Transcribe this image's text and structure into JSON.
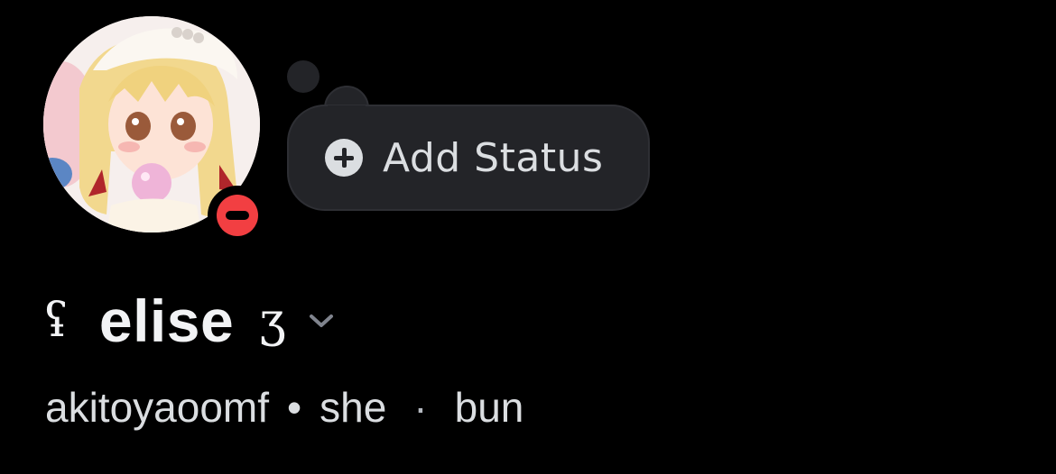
{
  "profile": {
    "display_name": "elise",
    "decoration_left": "ʢ",
    "decoration_right": "ʒ",
    "username": "akitoyaoomf",
    "separator_1": "•",
    "pronoun": "she",
    "separator_2": "·",
    "extra": "bun",
    "presence": "do-not-disturb"
  },
  "status": {
    "button_label": "Add Status",
    "icon": "plus-circle-icon"
  },
  "icons": {
    "expand": "chevron-down-icon",
    "presence": "dnd-status-icon"
  },
  "colors": {
    "background": "#000000",
    "bubble": "#232428",
    "dnd_red": "#f23f42",
    "text": "#f2f3f5",
    "muted": "#dbdee1"
  }
}
